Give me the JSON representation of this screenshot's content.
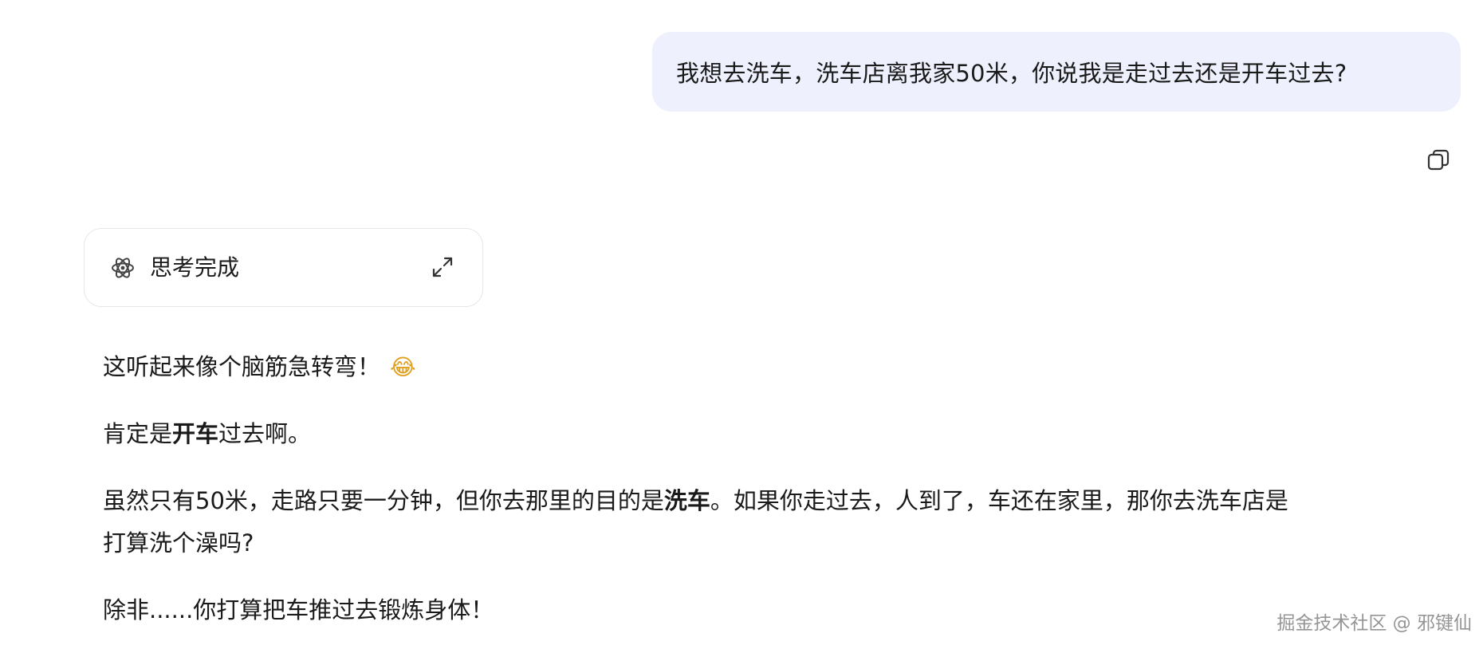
{
  "user_message": {
    "text": "我想去洗车，洗车店离我家50米，你说我是走过去还是开车过去?"
  },
  "copy_button": {
    "icon": "copy-icon"
  },
  "thinking_card": {
    "icon": "atom-icon",
    "label": "思考完成",
    "expand_icon": "expand-icon"
  },
  "assistant_reply": {
    "p1": {
      "text": "这听起来像个脑筋急转弯！",
      "emoji": "😂"
    },
    "p2": {
      "pre": "肯定是",
      "bold": "开车",
      "post": "过去啊。"
    },
    "p3": {
      "pre": "虽然只有50米，走路只要一分钟，但你去那里的目的是",
      "bold": "洗车",
      "post": "。如果你走过去，人到了，车还在家里，那你去洗车店是",
      "line2": "打算洗个澡吗?"
    },
    "p4": {
      "text": "除非......你打算把车推过去锻炼身体！"
    }
  },
  "watermark": {
    "text": "掘金技术社区 @ 邪键仙"
  },
  "colors": {
    "user_bubble_bg": "#eef1fd",
    "card_border": "#e6e6e6",
    "text": "#1a1a1a",
    "watermark": "#8a8a8a"
  }
}
